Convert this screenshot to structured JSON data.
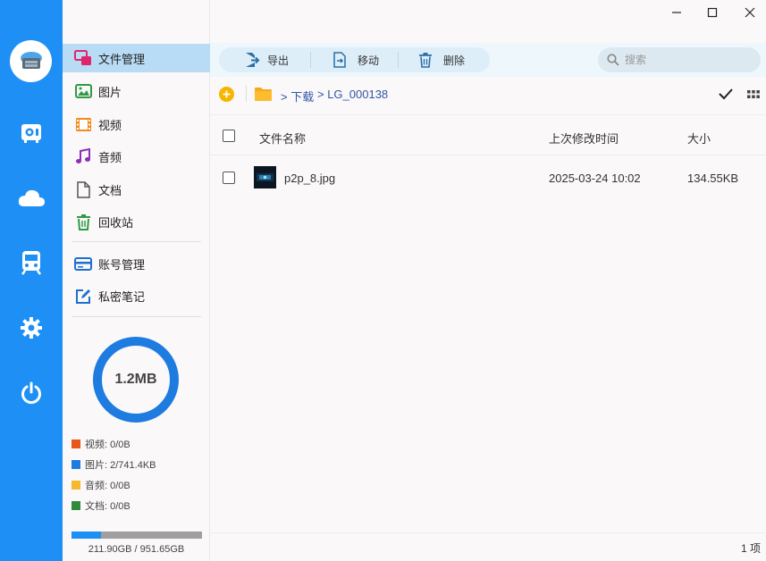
{
  "rail": {
    "icons": [
      "app-logo-icon",
      "safe-box-icon",
      "cloud-icon",
      "transfer-icon",
      "gear-icon",
      "power-icon"
    ]
  },
  "nav": {
    "items": [
      {
        "label": "文件管理",
        "icon": "file-manager-icon"
      },
      {
        "label": "图片",
        "icon": "image-icon"
      },
      {
        "label": "视频",
        "icon": "video-icon"
      },
      {
        "label": "音频",
        "icon": "music-icon"
      },
      {
        "label": "文档",
        "icon": "document-icon"
      },
      {
        "label": "回收站",
        "icon": "trash-icon"
      },
      {
        "label": "账号管理",
        "icon": "account-card-icon"
      },
      {
        "label": "私密笔记",
        "icon": "note-edit-icon"
      }
    ],
    "storage": {
      "used": "1.2MB",
      "legend": [
        {
          "label": "视频: 0/0B",
          "color": "#e8561c"
        },
        {
          "label": "图片: 2/741.4KB",
          "color": "#1e7be0"
        },
        {
          "label": "音频: 0/0B",
          "color": "#f5b82e"
        },
        {
          "label": "文档: 0/0B",
          "color": "#2f8a3c"
        }
      ],
      "disk_text": "211.90GB / 951.65GB",
      "disk_fraction": 0.2227
    }
  },
  "toolbar": {
    "export_label": "导出",
    "move_label": "移动",
    "delete_label": "删除",
    "search_placeholder": "搜索"
  },
  "path": {
    "segments": [
      "> 下载",
      "> LG_000138"
    ]
  },
  "table": {
    "headers": {
      "name": "文件名称",
      "modified": "上次修改时间",
      "size": "大小"
    },
    "rows": [
      {
        "name": "p2p_8.jpg",
        "modified": "2025-03-24 10:02",
        "size": "134.55KB"
      }
    ]
  },
  "status": {
    "count": "1 项"
  },
  "colors": {
    "accent": "#1e90f5",
    "active_nav": "#b8dcf5"
  }
}
